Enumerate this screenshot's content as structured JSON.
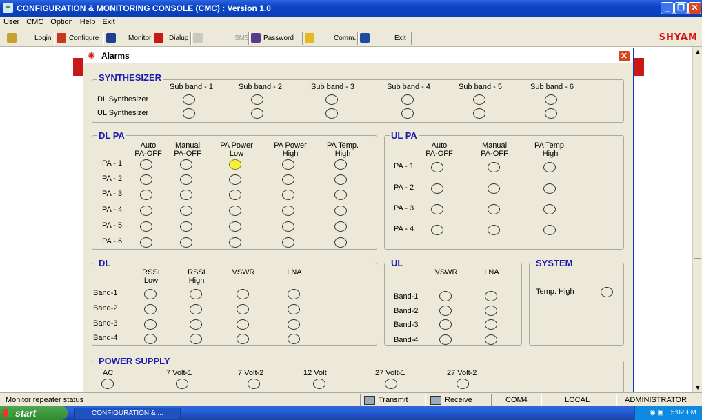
{
  "window": {
    "title": "CONFIGURATION & MONITORING CONSOLE (CMC)  :  Version 1.0"
  },
  "menu": [
    "User",
    "CMC",
    "Option",
    "Help",
    "Exit"
  ],
  "toolbar": {
    "login": "Login",
    "configure": "Configure",
    "monitor": "Monitor",
    "dialup": "Dialup",
    "sms": "SMS",
    "password": "Password",
    "comm": "Comm.",
    "exit": "Exit"
  },
  "brand": "SHYAM",
  "dialog": {
    "title": "Alarms"
  },
  "synthesizer": {
    "title": "SYNTHESIZER",
    "columns": [
      "Sub band - 1",
      "Sub band - 2",
      "Sub band - 3",
      "Sub band - 4",
      "Sub band - 5",
      "Sub band - 6"
    ],
    "rows": [
      "DL Synthesizer",
      "UL Synthesizer"
    ]
  },
  "dlpa": {
    "title": "DL PA",
    "columns": [
      "Auto\nPA-OFF",
      "Manual\nPA-OFF",
      "PA Power\nLow",
      "PA Power\nHigh",
      "PA Temp.\nHigh"
    ],
    "rows": [
      "PA - 1",
      "PA - 2",
      "PA - 3",
      "PA - 4",
      "PA - 5",
      "PA - 6"
    ],
    "active": [
      [
        0,
        2
      ]
    ]
  },
  "ulpa": {
    "title": "UL PA",
    "columns": [
      "Auto\nPA-OFF",
      "Manual\nPA-OFF",
      "PA Temp.\nHigh"
    ],
    "rows": [
      "PA - 1",
      "PA - 2",
      "PA - 3",
      "PA - 4"
    ]
  },
  "dl": {
    "title": "DL",
    "columns": [
      "RSSI\nLow",
      "RSSI\nHigh",
      "VSWR",
      "LNA"
    ],
    "rows": [
      "Band-1",
      "Band-2",
      "Band-3",
      "Band-4"
    ]
  },
  "ul": {
    "title": "UL",
    "columns": [
      "VSWR",
      "LNA"
    ],
    "rows": [
      "Band-1",
      "Band-2",
      "Band-3",
      "Band-4"
    ]
  },
  "system": {
    "title": "SYSTEM",
    "label": "Temp. High"
  },
  "power": {
    "title": "POWER SUPPLY",
    "items": [
      "AC",
      "7 Volt-1",
      "7 Volt-2",
      "12 Volt",
      "27 Volt-1",
      "27 Volt-2"
    ]
  },
  "status": {
    "message": "Monitor repeater status",
    "transmit": "Transmit",
    "receive": "Receive",
    "port": "COM4",
    "mode": "LOCAL",
    "user": "ADMINISTRATOR"
  },
  "taskbar": {
    "start": "start",
    "item": "CONFIGURATION & ...",
    "clock": "5:02 PM"
  },
  "colors": {
    "alarm_active": "#f6f03a",
    "title_blue": "#0a3eb8",
    "group_title": "#1a1ab0",
    "brand_red": "#d41010"
  }
}
